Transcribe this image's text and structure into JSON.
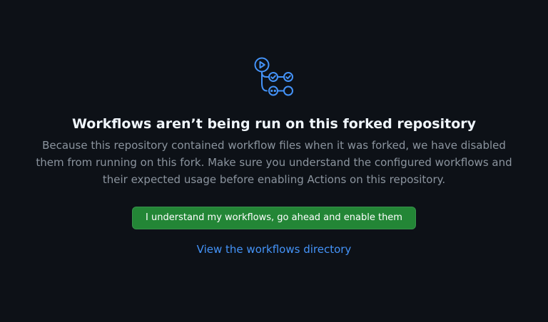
{
  "icon": {
    "name": "workflow-icon",
    "color": "#4493f8"
  },
  "title": "Workflows aren’t being run on this forked repository",
  "message": "Because this repository contained workflow files when it was forked, we have disabled them from running on this fork. Make sure you understand the configured workflows and their expected usage before enabling Actions on this repository.",
  "enable_button": {
    "label": "I understand my workflows, go ahead and enable them",
    "color": "#238636"
  },
  "directory_link": {
    "label": "View the workflows directory",
    "color": "#4493f8"
  }
}
